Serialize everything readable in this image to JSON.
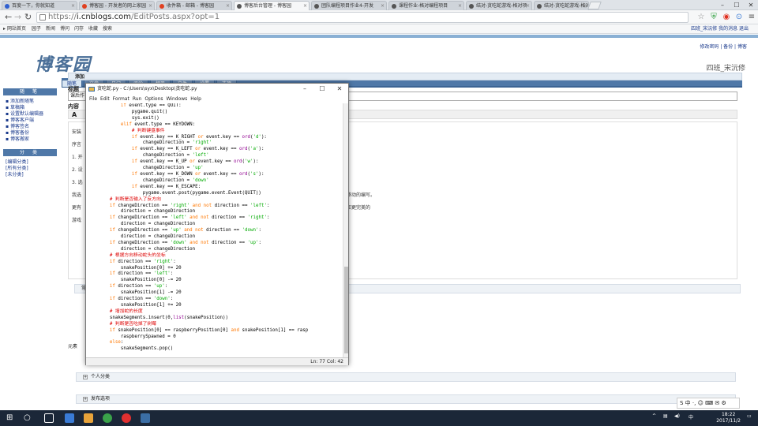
{
  "browser": {
    "tabs": [
      {
        "title": "百度一下，你就知道",
        "color": "#3060d0"
      },
      {
        "title": "博客园 - 开发者的网上家园",
        "color": "#e04020"
      },
      {
        "title": "收件箱 - 邮箱 - 博客园",
        "color": "#e04020"
      },
      {
        "title": "博客后台管理 - 博客园",
        "color": "#555555"
      },
      {
        "title": "团队编程项目作业4-开发",
        "color": "#555555"
      },
      {
        "title": "课程作业-格对编程项目",
        "color": "#555555"
      },
      {
        "title": "结对-贪吃蛇游戏-格对项",
        "color": "#555555"
      },
      {
        "title": "结对-贪吃蛇游戏-格对项",
        "color": "#555555"
      }
    ],
    "active_tab": 3,
    "url_prefix": "https://",
    "url_host": "i.cnblogs.com",
    "url_path": "/EditPosts.aspx?opt=1",
    "bookmarks": [
      "网站首页",
      "园子",
      "新闻",
      "博问",
      "闪存",
      "收藏",
      "搜索"
    ],
    "top_right_links": "四班_宋沅修  我的消息  退出"
  },
  "blog": {
    "logo": "博客园",
    "top_links": "修改密码 | 备份 | 博客",
    "nickname": "四班_宋沅修",
    "tabs": [
      "随笔",
      "文章",
      "日记",
      "评论",
      "相册",
      "文件",
      "设置",
      "选项"
    ],
    "side_head_1": "随 笔",
    "side_items_1": [
      "添加新随笔",
      "草稿箱",
      "设置默认编辑器",
      "博客客户端",
      "博客签名",
      "博客备份",
      "博客搬家"
    ],
    "side_head_2": "分 类",
    "side_items_2": [
      "[编辑分类]",
      "[所有分类]",
      "[未分类]"
    ],
    "add_head": "添加",
    "title_label": "标题",
    "title_value": "课后作",
    "content_label": "内容",
    "content_lines": [
      "安装",
      "序言",
      "1. 开",
      "2. 设",
      "3. 选",
      "我选",
      "更有",
      "游戏"
    ],
    "content_right_1": "移动的编写。",
    "content_right_2": "和更完美的",
    "bottom_label": "元素",
    "sections": [
      "常用",
      "个人分类",
      "发布选项"
    ]
  },
  "idle": {
    "title": "贪吃蛇.py - C:\\Users\\syx\\Desktop\\贪吃蛇.py",
    "menu": [
      "File",
      "Edit",
      "Format",
      "Run",
      "Options",
      "Windows",
      "Help"
    ],
    "status": "Ln: 77 Col: 42",
    "code": [
      "            if event.type == QUIT:",
      "                pygame.quit()",
      "                sys.exit()",
      "            elif event.type == KEYDOWN:",
      "                # 判断键盘事件",
      "                if event.key == K_RIGHT or event.key == ord('d'):",
      "                    changeDirection = 'right'",
      "                if event.key == K_LEFT or event.key == ord('a'):",
      "                    changeDirection = 'left'",
      "                if event.key == K_UP or event.key == ord('w'):",
      "                    changeDirection = 'up'",
      "                if event.key == K_DOWN or event.key == ord('s'):",
      "                    changeDirection = 'down'",
      "                if event.key == K_ESCAPE:",
      "                    pygame.event.post(pygame.event.Event(QUIT))",
      "        # 判断是否输入了反方向",
      "        if changeDirection == 'right' and not direction == 'left':",
      "            direction = changeDirection",
      "        if changeDirection == 'left' and not direction == 'right':",
      "            direction = changeDirection",
      "        if changeDirection == 'up' and not direction == 'down':",
      "            direction = changeDirection",
      "        if changeDirection == 'down' and not direction == 'up':",
      "            direction = changeDirection",
      "        # 根据方向移动蛇头的坐标",
      "        if direction == 'right':",
      "            snakePosition[0] += 20",
      "        if direction == 'left':",
      "            snakePosition[0] -= 20",
      "        if direction == 'up':",
      "            snakePosition[1] -= 20",
      "        if direction == 'down':",
      "            snakePosition[1] += 20",
      "        # 增加蛇的长度",
      "        snakeSegments.insert(0,list(snakePosition))",
      "        # 判断是否吃掉了树莓",
      "        if snakePosition[0] == raspberryPosition[0] and snakePosition[1] == rasp",
      "            raspberrySpawned = 0",
      "        else:",
      "            snakeSegments.pop()"
    ]
  },
  "taskbar": {
    "time": "18:22",
    "date": "2017/11/2",
    "ime": "中",
    "ime_panel": "S 中 ·, ☺ ⌨ ✉ ⚙"
  }
}
